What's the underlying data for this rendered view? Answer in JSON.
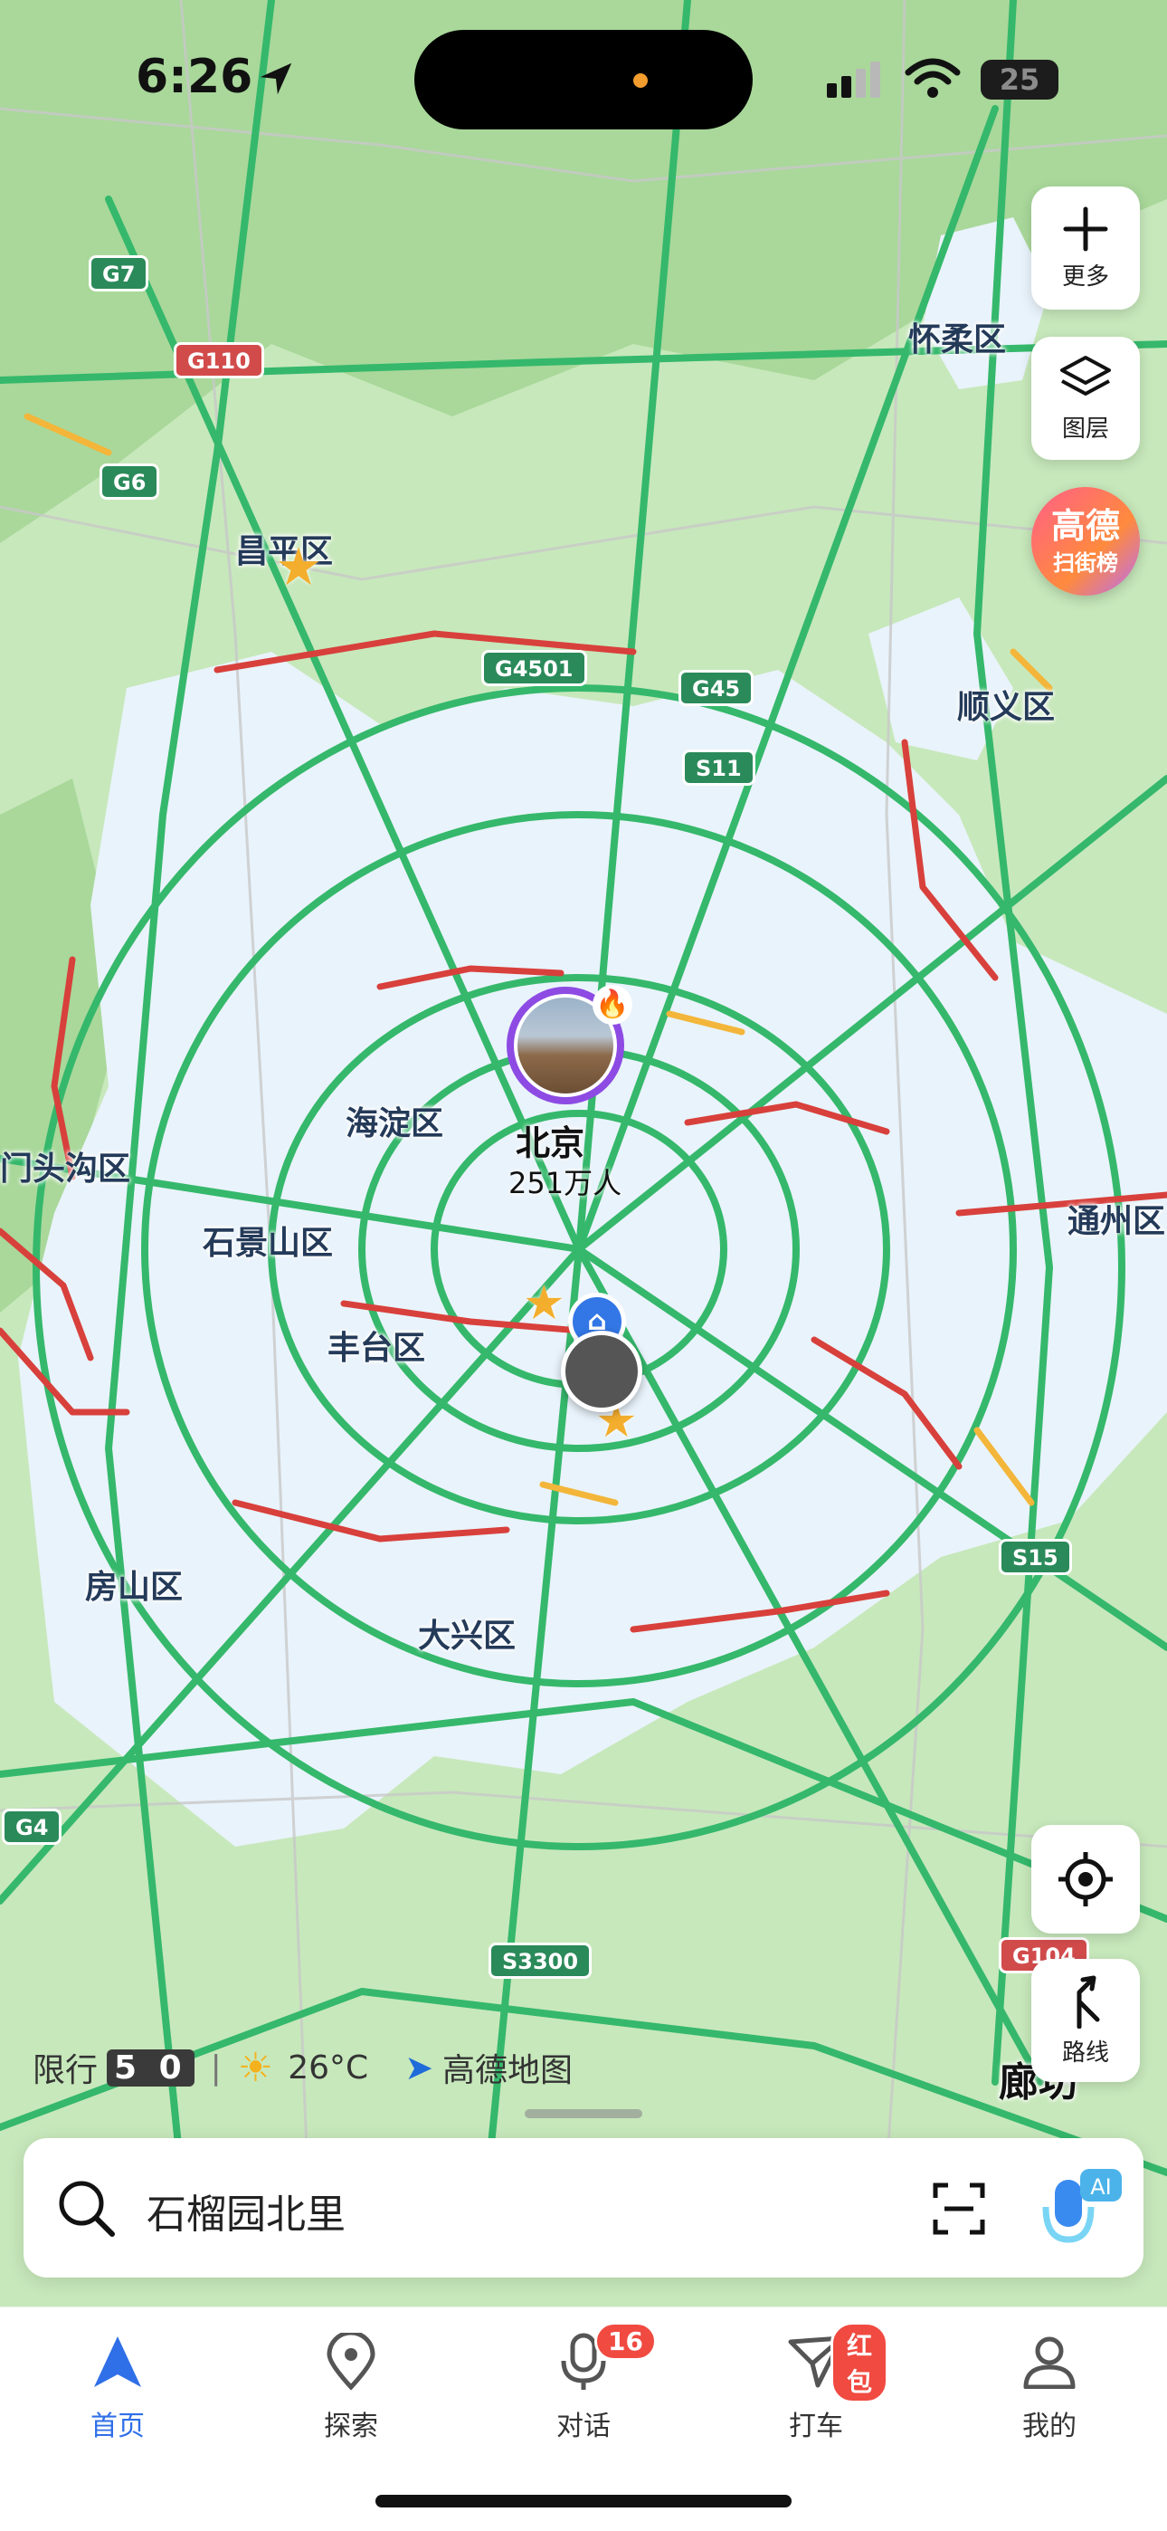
{
  "status_bar": {
    "time": "6:26",
    "battery": "25"
  },
  "map": {
    "districts": [
      "怀柔区",
      "昌平区",
      "顺义区",
      "海淀区",
      "门头沟区",
      "石景山区",
      "通州区",
      "丰台区",
      "房山区",
      "大兴区",
      "廊坊"
    ],
    "roads": [
      "G7",
      "G110",
      "G6",
      "G4501",
      "G45",
      "S11",
      "S15",
      "G4",
      "S3300",
      "G104"
    ],
    "city": {
      "name": "北京",
      "count": "251万人"
    }
  },
  "right_controls": {
    "more_label": "更多",
    "layers_label": "图层",
    "gaode_line1": "高德",
    "gaode_line2": "扫街榜",
    "route_label": "路线"
  },
  "info_bar": {
    "restriction_label": "限行",
    "restriction_plate": "5 0",
    "temperature": "26°C",
    "brand": "高德地图"
  },
  "search": {
    "text": "石榴园北里",
    "ai_label": "AI"
  },
  "tabs": [
    {
      "label": "首页",
      "active": true
    },
    {
      "label": "探索"
    },
    {
      "label": "对话",
      "badge": "16"
    },
    {
      "label": "打车",
      "badge": "红包"
    },
    {
      "label": "我的"
    }
  ],
  "colors": {
    "accent": "#2f6fe8",
    "badge": "#f04a41",
    "traffic_green": "#35b86b",
    "traffic_red": "#d8403c"
  }
}
